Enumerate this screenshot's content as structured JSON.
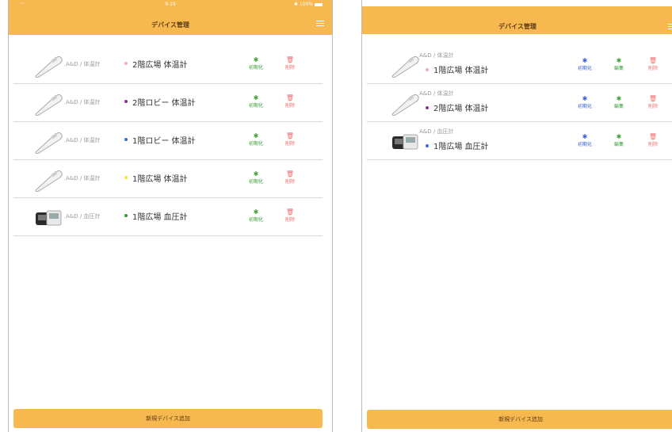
{
  "colors": {
    "accent": "#f6b84f",
    "green": "#3aa03a",
    "red": "#ef6e6e",
    "blue": "#3b63d8"
  },
  "left": {
    "status": {
      "time": "9:19",
      "battery": "100%"
    },
    "title": "デバイス管理",
    "actions": {
      "init": "初期化",
      "delete": "削除"
    },
    "devices": [
      {
        "maker": "A&D / 体温計",
        "name": "2階広場 体温計",
        "dot": "#f4a7c0",
        "type": "thermometer"
      },
      {
        "maker": "A&D / 体温計",
        "name": "2階ロビー 体温計",
        "dot": "#8e2aa6",
        "type": "thermometer"
      },
      {
        "maker": "A&D / 体温計",
        "name": "1階ロビー 体温計",
        "dot": "#2a6fe0",
        "type": "thermometer"
      },
      {
        "maker": "A&D / 体温計",
        "name": "1階広場 体温計",
        "dot": "#f2e63a",
        "type": "thermometer"
      },
      {
        "maker": "A&D / 血圧計",
        "name": "1階広場 血圧計",
        "dot": "#2a9a3a",
        "type": "bp-monitor"
      }
    ],
    "add_button": "新規デバイス追加"
  },
  "right": {
    "title": "デバイス管理",
    "actions": {
      "init": "初期化",
      "edit": "編集",
      "delete": "削除"
    },
    "devices": [
      {
        "maker": "A&D / 体温計",
        "name": "1階広場 体温計",
        "dot": "#f4a7c0",
        "type": "thermometer"
      },
      {
        "maker": "A&D / 体温計",
        "name": "2階広場 体温計",
        "dot": "#8e2aa6",
        "type": "thermometer"
      },
      {
        "maker": "A&D / 血圧計",
        "name": "1階広場 血圧計",
        "dot": "#2a6fe0",
        "type": "bp-monitor"
      }
    ],
    "add_button": "新規デバイス追加"
  }
}
